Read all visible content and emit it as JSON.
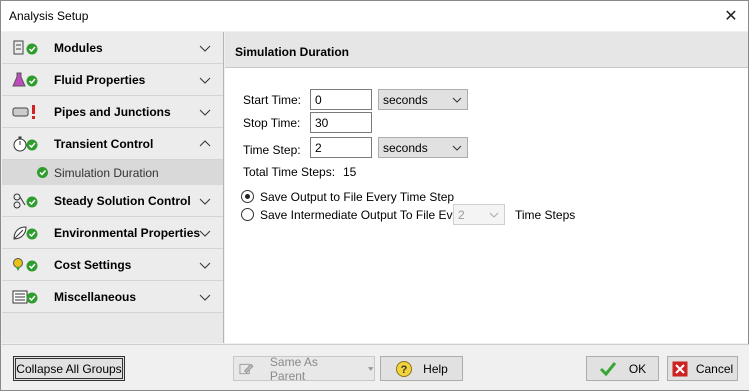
{
  "window": {
    "title": "Analysis Setup"
  },
  "sidebar": {
    "groups": [
      {
        "label": "Modules",
        "icon": "modules-icon",
        "expanded": false
      },
      {
        "label": "Fluid Properties",
        "icon": "flask-icon",
        "expanded": false
      },
      {
        "label": "Pipes and Junctions",
        "icon": "pipe-icon",
        "expanded": false
      },
      {
        "label": "Transient Control",
        "icon": "stopwatch-icon",
        "expanded": true
      },
      {
        "label": "Steady Solution Control",
        "icon": "solver-icon",
        "expanded": false
      },
      {
        "label": "Environmental Properties",
        "icon": "leaf-icon",
        "expanded": false
      },
      {
        "label": "Cost Settings",
        "icon": "coins-icon",
        "expanded": false
      },
      {
        "label": "Miscellaneous",
        "icon": "list-icon",
        "expanded": false
      }
    ],
    "sub_item": {
      "label": "Simulation Duration"
    }
  },
  "panel": {
    "title": "Simulation Duration",
    "start_time": {
      "label": "Start Time:",
      "value": "0",
      "unit": "seconds"
    },
    "stop_time": {
      "label": "Stop Time:",
      "value": "30"
    },
    "time_step": {
      "label": "Time Step:",
      "value": "2",
      "unit": "seconds"
    },
    "total_steps": {
      "label": "Total Time Steps:",
      "value": "15"
    },
    "radio_every": {
      "label": "Save Output to File Every Time Step",
      "selected": true
    },
    "radio_intermediate": {
      "label": "Save Intermediate Output To File Every",
      "selected": false,
      "value": "2",
      "suffix": "Time Steps"
    }
  },
  "footer": {
    "collapse_label": "Collapse All Groups",
    "same_as_parent_label": "Same As Parent",
    "help_label": "Help",
    "ok_label": "OK",
    "cancel_label": "Cancel"
  },
  "colors": {
    "status_green": "#2e9d2e",
    "error_red": "#d42020",
    "cancel_red": "#cc2222",
    "ok_green": "#3aa63a"
  }
}
